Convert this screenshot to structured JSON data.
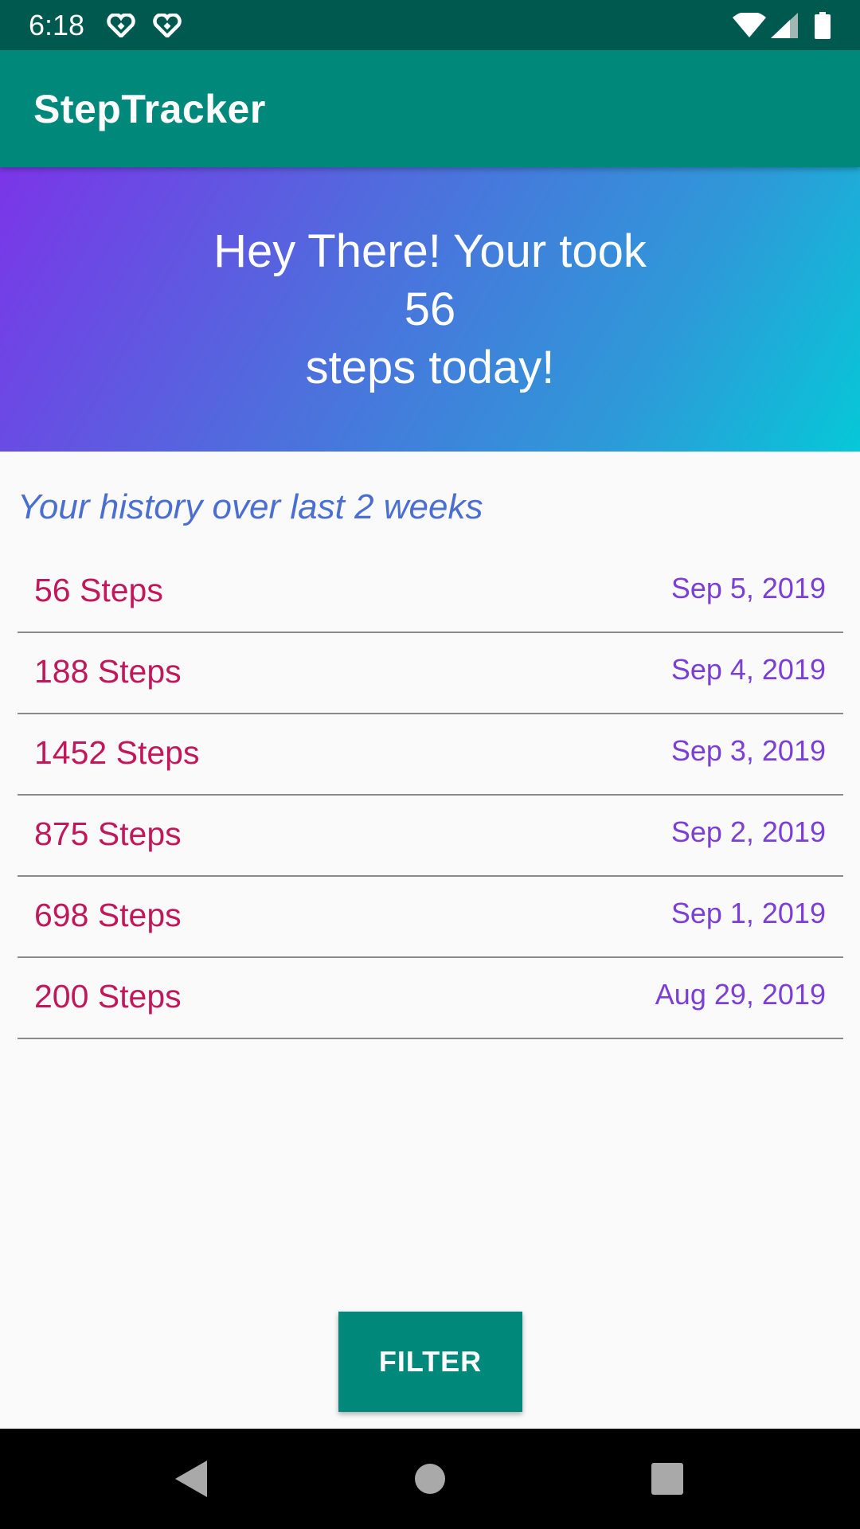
{
  "status_bar": {
    "time": "6:18",
    "left_icons": [
      "heart-icon",
      "heart-icon"
    ],
    "right_icons": [
      "wifi-icon",
      "cell-signal-icon",
      "battery-icon"
    ]
  },
  "app_bar": {
    "title": "StepTracker",
    "color": "#00897b"
  },
  "banner": {
    "line1": "Hey There! Your took",
    "steps": "56",
    "line3": "steps today!"
  },
  "history": {
    "title": "Your history over last 2 weeks",
    "rows": [
      {
        "steps": "56 Steps",
        "date": "Sep 5, 2019"
      },
      {
        "steps": "188 Steps",
        "date": "Sep 4, 2019"
      },
      {
        "steps": "1452 Steps",
        "date": "Sep 3, 2019"
      },
      {
        "steps": "875 Steps",
        "date": "Sep 2, 2019"
      },
      {
        "steps": "698 Steps",
        "date": "Sep 1, 2019"
      },
      {
        "steps": "200 Steps",
        "date": "Aug 29, 2019"
      }
    ]
  },
  "filter_button": {
    "label": "FILTER"
  },
  "nav_bar": {
    "icons": [
      "back-icon",
      "home-icon",
      "recents-icon"
    ]
  }
}
